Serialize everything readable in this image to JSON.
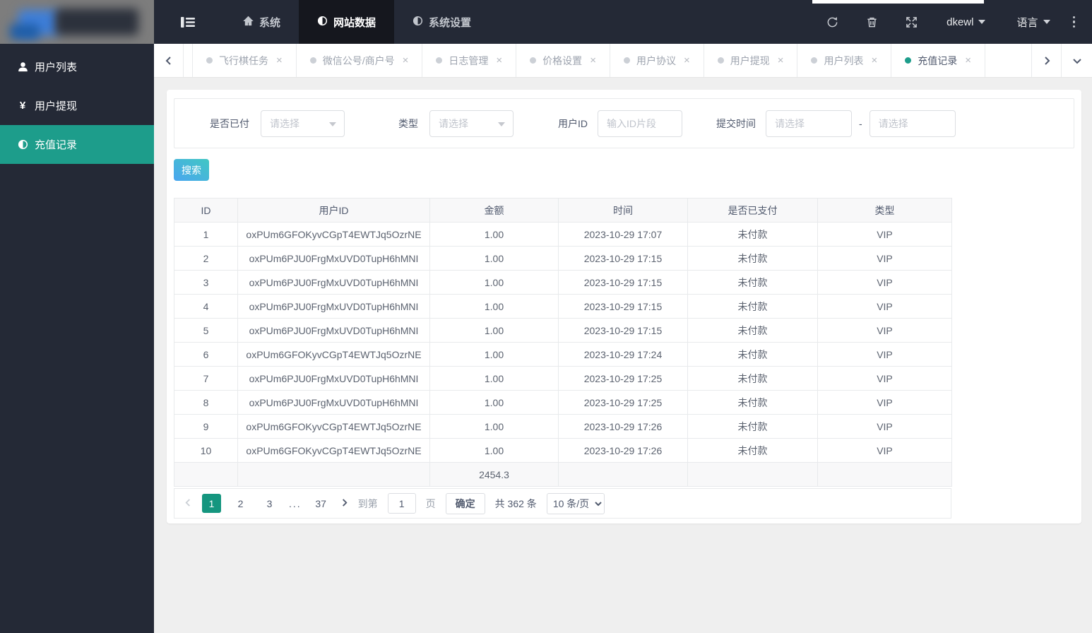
{
  "navbar": {
    "items": [
      {
        "key": "system",
        "label": "系统",
        "icon": "home-icon",
        "active": false
      },
      {
        "key": "site-data",
        "label": "网站数据",
        "icon": "contrast-icon",
        "active": true
      },
      {
        "key": "system-settings",
        "label": "系统设置",
        "icon": "contrast-icon",
        "active": false
      }
    ],
    "username": "dkewl",
    "language_label": "语言"
  },
  "sidebar": {
    "items": [
      {
        "key": "user-list",
        "label": "用户列表",
        "icon": "user-icon",
        "active": false
      },
      {
        "key": "user-withdraw",
        "label": "用户提现",
        "icon": "yen-icon",
        "active": false
      },
      {
        "key": "recharge-records",
        "label": "充值记录",
        "icon": "contrast-icon",
        "active": true
      }
    ]
  },
  "tabs": {
    "items": [
      {
        "key": "flight-chess-task",
        "label": "飞行棋任务",
        "active": false
      },
      {
        "key": "wechat-account",
        "label": "微信公号/商户号",
        "active": false
      },
      {
        "key": "log-management",
        "label": "日志管理",
        "active": false
      },
      {
        "key": "price-settings",
        "label": "价格设置",
        "active": false
      },
      {
        "key": "user-agreement",
        "label": "用户协议",
        "active": false
      },
      {
        "key": "user-withdraw",
        "label": "用户提现",
        "active": false
      },
      {
        "key": "user-list",
        "label": "用户列表",
        "active": false
      },
      {
        "key": "recharge-records",
        "label": "充值记录",
        "active": true
      }
    ]
  },
  "filters": {
    "paid_label": "是否已付",
    "paid_placeholder": "请选择",
    "type_label": "类型",
    "type_placeholder": "请选择",
    "userid_label": "用户ID",
    "userid_placeholder": "输入ID片段",
    "time_label": "提交时间",
    "time_from_placeholder": "请选择",
    "time_to_placeholder": "请选择",
    "time_separator": "-",
    "search_label": "搜索"
  },
  "table": {
    "headers": [
      "ID",
      "用户ID",
      "金额",
      "时间",
      "是否已支付",
      "类型"
    ],
    "rows": [
      [
        "1",
        "oxPUm6GFOKyvCGpT4EWTJq5OzrNE",
        "1.00",
        "2023-10-29 17:07",
        "未付款",
        "VIP"
      ],
      [
        "2",
        "oxPUm6PJU0FrgMxUVD0TupH6hMNI",
        "1.00",
        "2023-10-29 17:15",
        "未付款",
        "VIP"
      ],
      [
        "3",
        "oxPUm6PJU0FrgMxUVD0TupH6hMNI",
        "1.00",
        "2023-10-29 17:15",
        "未付款",
        "VIP"
      ],
      [
        "4",
        "oxPUm6PJU0FrgMxUVD0TupH6hMNI",
        "1.00",
        "2023-10-29 17:15",
        "未付款",
        "VIP"
      ],
      [
        "5",
        "oxPUm6PJU0FrgMxUVD0TupH6hMNI",
        "1.00",
        "2023-10-29 17:15",
        "未付款",
        "VIP"
      ],
      [
        "6",
        "oxPUm6GFOKyvCGpT4EWTJq5OzrNE",
        "1.00",
        "2023-10-29 17:24",
        "未付款",
        "VIP"
      ],
      [
        "7",
        "oxPUm6PJU0FrgMxUVD0TupH6hMNI",
        "1.00",
        "2023-10-29 17:25",
        "未付款",
        "VIP"
      ],
      [
        "8",
        "oxPUm6PJU0FrgMxUVD0TupH6hMNI",
        "1.00",
        "2023-10-29 17:25",
        "未付款",
        "VIP"
      ],
      [
        "9",
        "oxPUm6GFOKyvCGpT4EWTJq5OzrNE",
        "1.00",
        "2023-10-29 17:26",
        "未付款",
        "VIP"
      ],
      [
        "10",
        "oxPUm6GFOKyvCGpT4EWTJq5OzrNE",
        "1.00",
        "2023-10-29 17:26",
        "未付款",
        "VIP"
      ]
    ],
    "summary_row": [
      "",
      "",
      "2454.3",
      "",
      "",
      ""
    ]
  },
  "pagination": {
    "pages": [
      {
        "label": "1",
        "active": true
      },
      {
        "label": "2",
        "active": false
      },
      {
        "label": "3",
        "active": false
      },
      {
        "label": "...",
        "ellipsis": true
      },
      {
        "label": "37",
        "active": false
      }
    ],
    "goto_label": "到第",
    "goto_value": "1",
    "page_word": "页",
    "confirm_label": "确定",
    "total_label": "共 362 条",
    "page_size_label": "10 条/页"
  },
  "colors": {
    "accent_teal": "#1d9d8b",
    "navbar_bg": "#242936",
    "navbar_active_bg": "#15171e",
    "search_gradient_start": "#41c7c3",
    "search_gradient_end": "#4aa6f0",
    "content_bg": "#efefef",
    "border": "#e8eaec"
  }
}
